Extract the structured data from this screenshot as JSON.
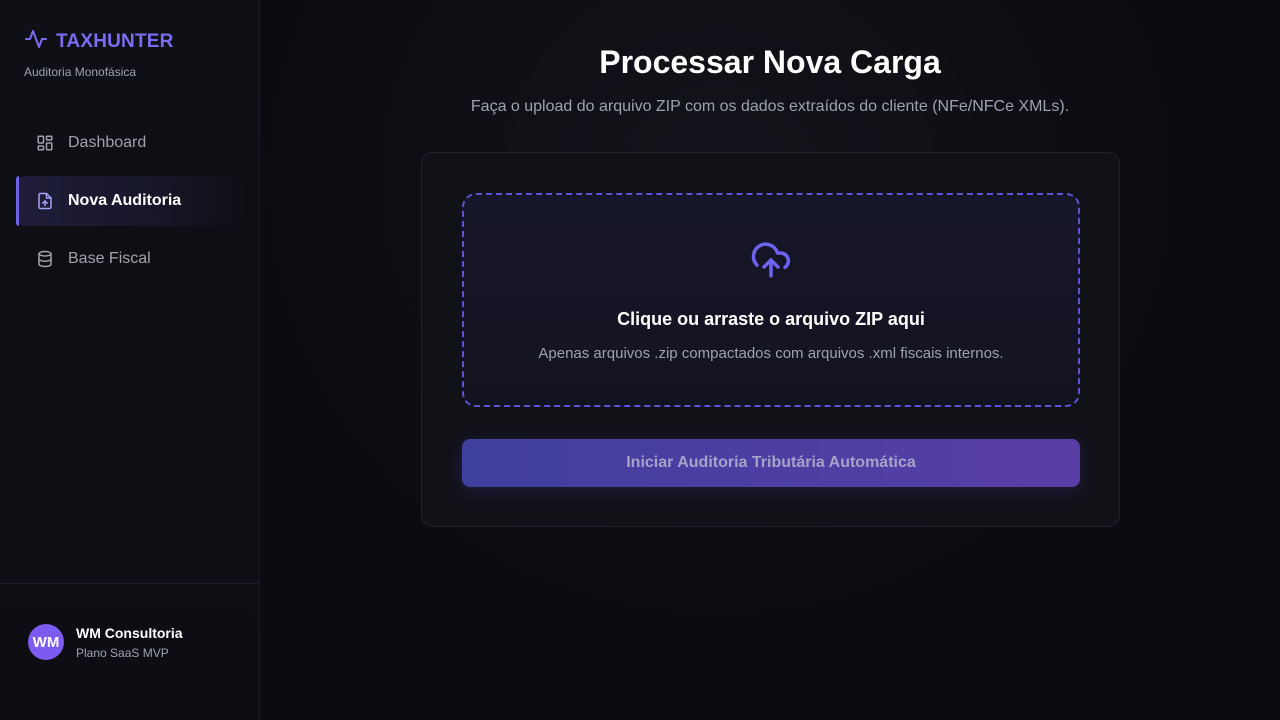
{
  "brand": {
    "name": "TAXHUNTER",
    "subtitle": "Auditoria Monofásica",
    "icon": "activity-icon",
    "accent": "#7c6cf2"
  },
  "sidebar": {
    "items": [
      {
        "label": "Dashboard",
        "icon": "layout-dashboard-icon",
        "active": false
      },
      {
        "label": "Nova Auditoria",
        "icon": "file-upload-icon",
        "active": true
      },
      {
        "label": "Base Fiscal",
        "icon": "database-icon",
        "active": false
      }
    ]
  },
  "user": {
    "initials": "WM",
    "name": "WM Consultoria",
    "plan": "Plano SaaS MVP",
    "avatar_color": "#7c5cf0"
  },
  "main": {
    "title": "Processar Nova Carga",
    "subtitle": "Faça o upload do arquivo ZIP com os dados extraídos do cliente (NFe/NFCe XMLs).",
    "dropzone": {
      "icon": "cloud-upload-icon",
      "title": "Clique ou arraste o arquivo ZIP aqui",
      "hint": "Apenas arquivos .zip compactados com arquivos .xml fiscais internos."
    },
    "start_button": "Iniciar Auditoria Tributária Automática"
  }
}
